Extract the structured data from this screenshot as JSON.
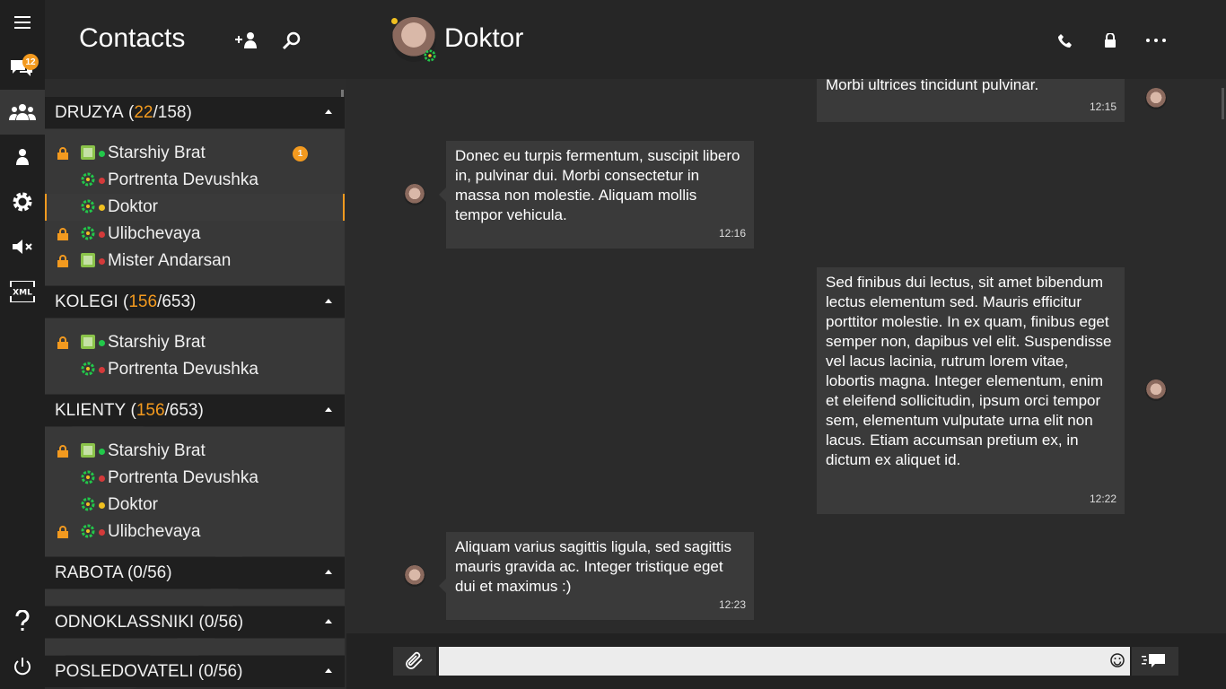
{
  "rail": {
    "items": [
      {
        "name": "menu-icon"
      },
      {
        "name": "chats-icon",
        "badge": "12"
      },
      {
        "name": "contacts-icon"
      },
      {
        "name": "profile-icon"
      },
      {
        "name": "settings-icon"
      },
      {
        "name": "mute-icon"
      },
      {
        "name": "xml-icon",
        "label": "XML"
      },
      {
        "name": "help-icon"
      },
      {
        "name": "power-icon"
      }
    ]
  },
  "contacts": {
    "title": "Contacts",
    "groups": [
      {
        "name": "DRUZYA",
        "online": "22",
        "total": "/158)",
        "contacts": [
          {
            "name": "Starshiy Brat",
            "status": "green",
            "lock": true,
            "net": "vk",
            "unread": "1"
          },
          {
            "name": "Portrenta Devushka",
            "status": "red",
            "lock": false,
            "net": "icq"
          },
          {
            "name": "Doktor",
            "status": "yellow",
            "lock": false,
            "net": "icq",
            "selected": true
          },
          {
            "name": "Ulibchevaya",
            "status": "red",
            "lock": true,
            "net": "icq"
          },
          {
            "name": "Mister Andarsan",
            "status": "red",
            "lock": true,
            "net": "vk"
          }
        ]
      },
      {
        "name": "KOLEGI",
        "online": "156",
        "total": "/653)",
        "contacts": [
          {
            "name": "Starshiy Brat",
            "status": "green",
            "lock": true,
            "net": "vk"
          },
          {
            "name": "Portrenta Devushka",
            "status": "red",
            "lock": false,
            "net": "icq"
          }
        ]
      },
      {
        "name": "KLIENTY",
        "online": "156",
        "total": "/653)",
        "contacts": [
          {
            "name": "Starshiy Brat",
            "status": "green",
            "lock": true,
            "net": "vk"
          },
          {
            "name": "Portrenta Devushka",
            "status": "red",
            "lock": false,
            "net": "icq"
          },
          {
            "name": "Doktor",
            "status": "yellow",
            "lock": false,
            "net": "icq"
          },
          {
            "name": "Ulibchevaya",
            "status": "red",
            "lock": true,
            "net": "icq"
          }
        ]
      },
      {
        "name": "RABOTA (0/56)"
      },
      {
        "name": "ODNOKLASSNIKI (0/56)"
      },
      {
        "name": "POSLEDOVATELI (0/56)"
      }
    ]
  },
  "chat": {
    "contact_name": "Doktor",
    "messages": [
      {
        "direction": "out",
        "text": "Morbi ultrices tincidunt pulvinar.",
        "time": "12:15"
      },
      {
        "direction": "in",
        "text": "Donec eu turpis fermentum, suscipit libero in, pulvinar dui. Morbi consectetur in massa non molestie. Aliquam mollis tempor vehicula.",
        "time": "12:16"
      },
      {
        "direction": "out",
        "text": "Sed finibus dui lectus, sit amet bibendum lectus elementum sed. Mauris efficitur porttitor molestie. In ex quam, finibus eget semper non, dapibus vel elit. Suspendisse vel lacus lacinia, rutrum lorem vitae, lobortis magna. Integer elementum, enim et eleifend sollicitudin, ipsum orci tempor sem, elementum vulputate urna elit non lacus. Etiam accumsan pretium ex, in dictum ex aliquet id.",
        "time": "12:22"
      },
      {
        "direction": "in",
        "text": "Aliquam varius sagittis ligula, sed sagittis mauris gravida ac. Integer tristique eget dui et maximus :)",
        "time": "12:23"
      }
    ],
    "input_value": ""
  },
  "colors": {
    "accent": "#f39a1f",
    "online": "#22c84a",
    "offline": "#d43a3a",
    "away": "#f0c020"
  }
}
